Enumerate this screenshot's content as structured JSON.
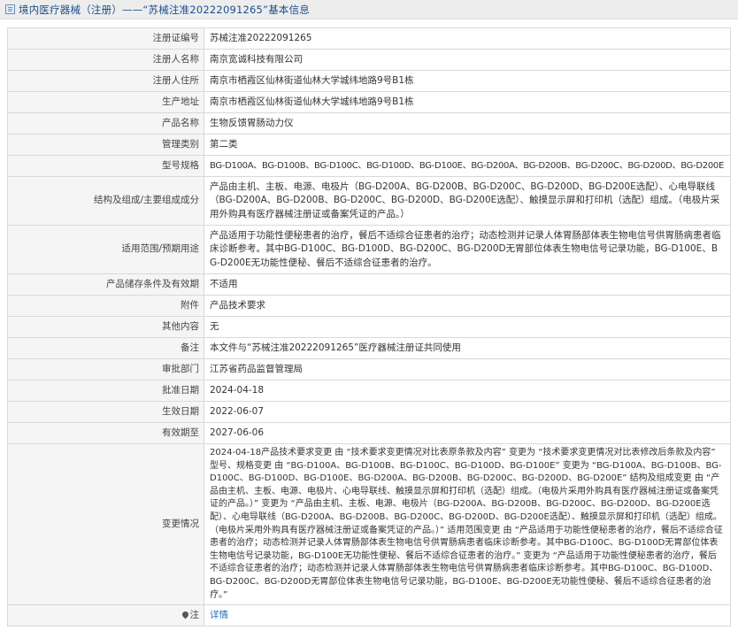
{
  "header": {
    "title": "境内医疗器械（注册）——“苏械注准20222091265”基本信息"
  },
  "rows": [
    {
      "label": "注册证编号",
      "value": "苏械注准20222091265"
    },
    {
      "label": "注册人名称",
      "value": "南京宽诚科技有限公司"
    },
    {
      "label": "注册人住所",
      "value": "南京市栖霞区仙林街道仙林大学城纬地路9号B1栋"
    },
    {
      "label": "生产地址",
      "value": "南京市栖霞区仙林街道仙林大学城纬地路9号B1栋"
    },
    {
      "label": "产品名称",
      "value": "生物反馈胃肠动力仪"
    },
    {
      "label": "管理类别",
      "value": "第二类"
    },
    {
      "label": "型号规格",
      "value": "BG-D100A、BG-D100B、BG-D100C、BG-D100D、BG-D100E、BG-D200A、BG-D200B、BG-D200C、BG-D200D、BG-D200E"
    },
    {
      "label": "结构及组成/主要组成成分",
      "value": "产品由主机、主板、电源、电极片（BG-D200A、BG-D200B、BG-D200C、BG-D200D、BG-D200E选配）、心电导联线（BG-D200A、BG-D200B、BG-D200C、BG-D200D、BG-D200E选配）、触摸显示屏和打印机（选配）组成。（电极片采用外购具有医疗器械注册证或备案凭证的产品。）"
    },
    {
      "label": "适用范围/预期用途",
      "value": "产品适用于功能性便秘患者的治疗，餐后不适综合征患者的治疗；动态检测并记录人体胃肠部体表生物电信号供胃肠病患者临床诊断参考。其中BG-D100C、BG-D100D、BG-D200C、BG-D200D无胃部位体表生物电信号记录功能，BG-D100E、BG-D200E无功能性便秘、餐后不适综合征患者的治疗。"
    },
    {
      "label": "产品储存条件及有效期",
      "value": "不适用"
    },
    {
      "label": "附件",
      "value": "产品技术要求"
    },
    {
      "label": "其他内容",
      "value": "无"
    },
    {
      "label": "备注",
      "value": "本文件与“苏械注准20222091265”医疗器械注册证共同使用"
    },
    {
      "label": "审批部门",
      "value": "江苏省药品监督管理局"
    },
    {
      "label": "批准日期",
      "value": "2024-04-18"
    },
    {
      "label": "生效日期",
      "value": "2022-06-07"
    },
    {
      "label": "有效期至",
      "value": "2027-06-06"
    },
    {
      "label": "变更情况",
      "value": "2024-04-18产品技术要求变更 由 “技术要求变更情况对比表原条款及内容” 变更为 “技术要求变更情况对比表修改后条款及内容” 型号、规格变更 由 “BG-D100A、BG-D100B、BG-D100C、BG-D100D、BG-D100E” 变更为 “BG-D100A、BG-D100B、BG-D100C、BG-D100D、BG-D100E、BG-D200A、BG-D200B、BG-D200C、BG-D200D、BG-D200E” 结构及组成变更 由 “产品由主机、主板、电源、电极片、心电导联线、触摸显示屏和打印机（选配）组成。（电极片采用外购具有医疗器械注册证或备案凭证的产品。）” 变更为 “产品由主机、主板、电源、电极片（BG-D200A、BG-D200B、BG-D200C、BG-D200D、BG-D200E选配）、心电导联线（BG-D200A、BG-D200B、BG-D200C、BG-D200D、BG-D200E选配）、触摸显示屏和打印机（选配）组成。（电极片采用外购具有医疗器械注册证或备案凭证的产品。）” 适用范围变更 由 “产品适用于功能性便秘患者的治疗，餐后不适综合征患者的治疗；动态检测并记录人体胃肠部体表生物电信号供胃肠病患者临床诊断参考。其中BG-D100C、BG-D100D无胃部位体表生物电信号记录功能，BG-D100E无功能性便秘、餐后不适综合征患者的治疗。” 变更为 “产品适用于功能性便秘患者的治疗，餐后不适综合征患者的治疗；动态检测并记录人体胃肠部体表生物电信号供胃肠病患者临床诊断参考。其中BG-D100C、BG-D100D、BG-D200C、BG-D200D无胃部位体表生物电信号记录功能，BG-D100E、BG-D200E无功能性便秘、餐后不适综合征患者的治疗。”"
    }
  ],
  "note_row": {
    "label": "注",
    "icon": "pin-icon",
    "link_text": "详情"
  }
}
